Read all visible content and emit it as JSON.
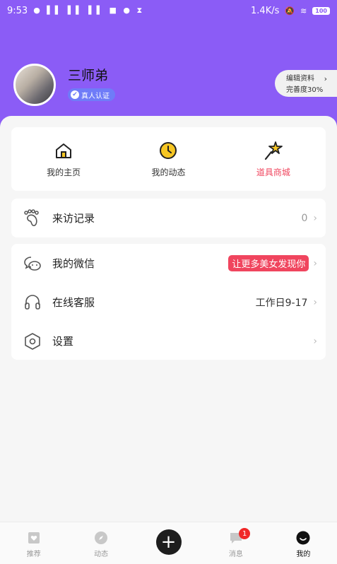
{
  "status_bar": {
    "time": "9:53",
    "speed": "1.4K/s",
    "battery": "100"
  },
  "profile": {
    "name": "三师弟",
    "badge": "真人认证",
    "edit_label": "编辑资料",
    "completion": "完善度30%"
  },
  "quick_links": [
    {
      "label": "我的主页",
      "icon": "home-icon"
    },
    {
      "label": "我的动态",
      "icon": "clock-icon"
    },
    {
      "label": "道具商城",
      "icon": "magic-wand-icon",
      "color": "#f0455e"
    }
  ],
  "visits": {
    "label": "来访记录",
    "count": "0"
  },
  "menu": [
    {
      "label": "我的微信",
      "badge": "让更多美女发现你",
      "icon": "wechat-icon"
    },
    {
      "label": "在线客服",
      "value": "工作日9-17",
      "icon": "headset-icon"
    },
    {
      "label": "设置",
      "icon": "settings-icon"
    }
  ],
  "tabs": [
    {
      "label": "推荐",
      "icon": "recommend-icon"
    },
    {
      "label": "动态",
      "icon": "compass-icon"
    },
    {
      "label": "",
      "icon": "plus-icon"
    },
    {
      "label": "消息",
      "icon": "message-icon",
      "badge": "1"
    },
    {
      "label": "我的",
      "icon": "profile-icon",
      "active": true
    }
  ],
  "colors": {
    "header": "#8b5cf6",
    "accent_red": "#f0455e",
    "badge_blue": "#6f7cf8"
  }
}
